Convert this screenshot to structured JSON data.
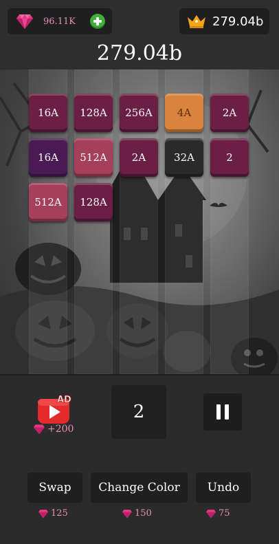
{
  "header": {
    "gems": "96.11K",
    "best_score": "279.04b",
    "current_score": "279.04b"
  },
  "board": {
    "theme": "halloween",
    "columns": 5,
    "tiles": [
      {
        "label": "16A",
        "col": 0,
        "row": 0,
        "color": "#6b1f45"
      },
      {
        "label": "128A",
        "col": 1,
        "row": 0,
        "color": "#6b1f45"
      },
      {
        "label": "256A",
        "col": 2,
        "row": 0,
        "color": "#6b1f45"
      },
      {
        "label": "4A",
        "col": 3,
        "row": 0,
        "color": "#d8843e",
        "text_color": "#5a2a10"
      },
      {
        "label": "2A",
        "col": 4,
        "row": 0,
        "color": "#6b1f45"
      },
      {
        "label": "16A",
        "col": 0,
        "row": 1,
        "color": "#4a1a55"
      },
      {
        "label": "512A",
        "col": 1,
        "row": 1,
        "color": "#a63f5c"
      },
      {
        "label": "2A",
        "col": 2,
        "row": 1,
        "color": "#6b1f45"
      },
      {
        "label": "32A",
        "col": 3,
        "row": 1,
        "color": "#2a2a2a"
      },
      {
        "label": "2",
        "col": 4,
        "row": 1,
        "color": "#6b1f45"
      },
      {
        "label": "512A",
        "col": 0,
        "row": 2,
        "color": "#a63f5c"
      },
      {
        "label": "128A",
        "col": 1,
        "row": 2,
        "color": "#6b1f45"
      }
    ]
  },
  "controls": {
    "ad_badge": "AD",
    "ad_reward": "+200",
    "next_tile": "2",
    "actions": [
      {
        "label": "Swap",
        "cost": "125"
      },
      {
        "label": "Change Color",
        "cost": "150"
      },
      {
        "label": "Undo",
        "cost": "75"
      }
    ]
  },
  "colors": {
    "gem": "#e23a86",
    "gem_text": "#e98fb7",
    "crown": "#f2a51a",
    "plus": "#3fae3a",
    "ad_red": "#e32b2b"
  }
}
